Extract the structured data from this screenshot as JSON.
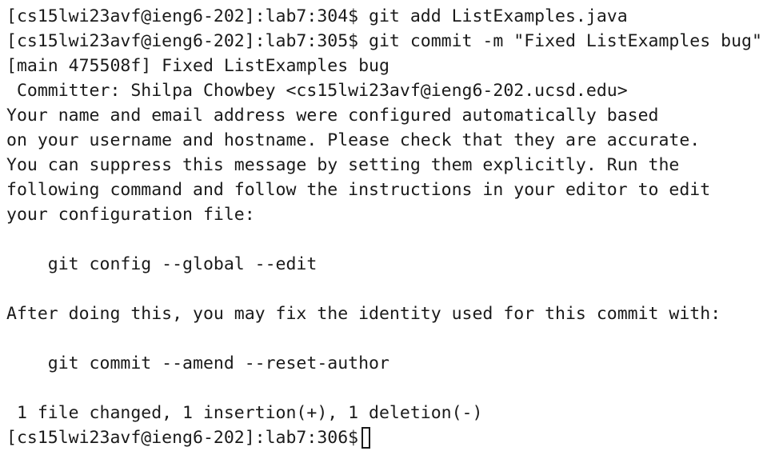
{
  "terminal": {
    "lines": [
      "[cs15lwi23avf@ieng6-202]:lab7:304$ git add ListExamples.java",
      "[cs15lwi23avf@ieng6-202]:lab7:305$ git commit -m \"Fixed ListExamples bug\"",
      "[main 475508f] Fixed ListExamples bug",
      " Committer: Shilpa Chowbey <cs15lwi23avf@ieng6-202.ucsd.edu>",
      "Your name and email address were configured automatically based",
      "on your username and hostname. Please check that they are accurate.",
      "You can suppress this message by setting them explicitly. Run the",
      "following command and follow the instructions in your editor to edit",
      "your configuration file:",
      "",
      "    git config --global --edit",
      "",
      "After doing this, you may fix the identity used for this commit with:",
      "",
      "    git commit --amend --reset-author",
      "",
      " 1 file changed, 1 insertion(+), 1 deletion(-)"
    ],
    "prompt": "[cs15lwi23avf@ieng6-202]:lab7:306$"
  }
}
